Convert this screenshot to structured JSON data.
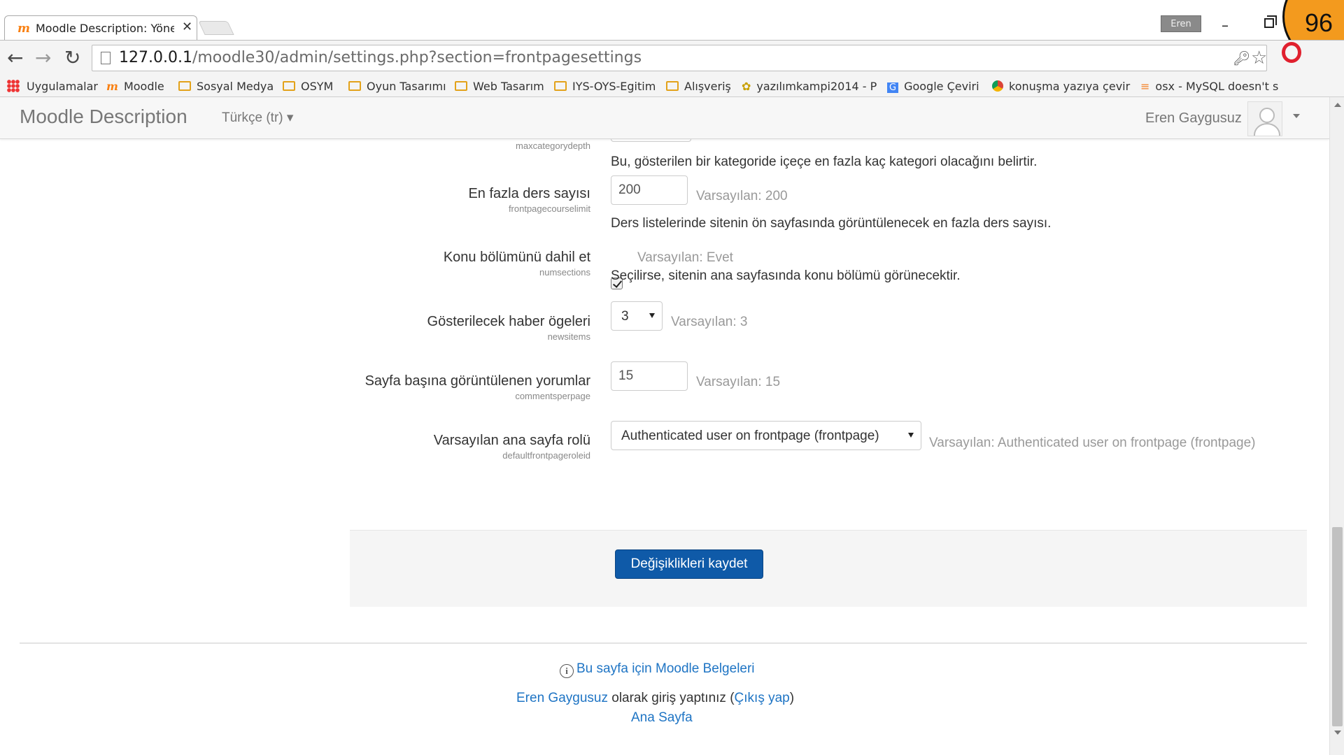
{
  "browser": {
    "tab_title": "Moodle Description: Yöne",
    "profile_name": "Eren",
    "counter_badge": "96",
    "url_host": "127.0.0.1",
    "url_path": "/moodle30/admin/settings.php?section=frontpagesettings",
    "bookmarks": [
      {
        "label": "Uygulamalar",
        "icon": "apps-grid-icon"
      },
      {
        "label": "Moodle",
        "icon": "moodle-icon"
      },
      {
        "label": "Sosyal Medya",
        "icon": "folder-icon"
      },
      {
        "label": "OSYM",
        "icon": "folder-icon"
      },
      {
        "label": "Oyun Tasarımı",
        "icon": "folder-icon"
      },
      {
        "label": "Web Tasarım",
        "icon": "folder-icon"
      },
      {
        "label": "IYS-OYS-Egitim",
        "icon": "folder-icon"
      },
      {
        "label": "Alışveriş",
        "icon": "folder-icon"
      },
      {
        "label": "yazılımkampi2014 - P",
        "icon": "bug-icon"
      },
      {
        "label": "Google Çeviri",
        "icon": "google-translate-icon"
      },
      {
        "label": "konuşma yazıya çevir",
        "icon": "chrome-icon"
      },
      {
        "label": "osx - MySQL doesn't s",
        "icon": "stackoverflow-icon"
      }
    ]
  },
  "moodle": {
    "brand": "Moodle Description",
    "language": "Türkçe (tr)",
    "user_name": "Eren Gaygusuz"
  },
  "settings": {
    "partial_key": "maxcategorydepth",
    "partial_desc": "Bu, gösterilen bir kategoride içeçe en fazla kaç kategori olacağını belirtir.",
    "course_limit": {
      "label": "En fazla ders sayısı",
      "key": "frontpagecourselimit",
      "value": "200",
      "default": "Varsayılan: 200",
      "desc": "Ders listelerinde sitenin ön sayfasında görüntülenecek en fazla ders sayısı."
    },
    "numsections": {
      "label": "Konu bölümünü dahil et",
      "key": "numsections",
      "checked": true,
      "default": "Varsayılan: Evet",
      "desc": "Seçilirse, sitenin ana sayfasında konu bölümü görünecektir."
    },
    "newsitems": {
      "label": "Gösterilecek haber ögeleri",
      "key": "newsitems",
      "value": "3",
      "default": "Varsayılan: 3"
    },
    "comments": {
      "label": "Sayfa başına görüntülenen yorumlar",
      "key": "commentsperpage",
      "value": "15",
      "default": "Varsayılan: 15"
    },
    "role": {
      "label": "Varsayılan ana sayfa rolü",
      "key": "defaultfrontpageroleid",
      "value": "Authenticated user on frontpage (frontpage)",
      "default": "Varsayılan: Authenticated user on frontpage (frontpage)"
    },
    "save_label": "Değişiklikleri kaydet"
  },
  "footer": {
    "docs_link": "Bu sayfa için Moodle Belgeleri",
    "login_user": "Eren Gaygusuz",
    "login_text": " olarak giriş yaptınız (",
    "logout": "Çıkış yap",
    "login_close": ")",
    "home": "Ana Sayfa"
  },
  "colors": {
    "link": "#1e74c4",
    "primary_button": "#0f5aa8",
    "moodle_orange": "#f98012"
  }
}
